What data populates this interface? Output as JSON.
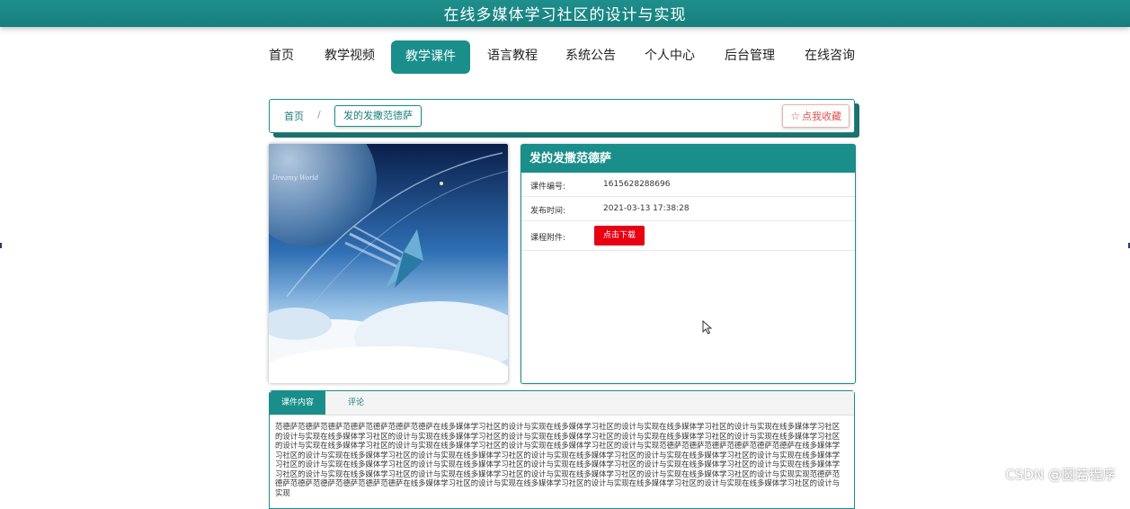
{
  "header": {
    "title": "在线多媒体学习社区的设计与实现"
  },
  "nav": {
    "items": [
      {
        "label": "首页",
        "active": false
      },
      {
        "label": "教学视频",
        "active": false
      },
      {
        "label": "教学课件",
        "active": true
      },
      {
        "label": "语言教程",
        "active": false
      },
      {
        "label": "系统公告",
        "active": false
      },
      {
        "label": "个人中心",
        "active": false
      },
      {
        "label": "后台管理",
        "active": false
      },
      {
        "label": "在线咨询",
        "active": false
      }
    ]
  },
  "breadcrumb": {
    "home": "首页",
    "separator": "/",
    "current": "发的发撒范德萨"
  },
  "favorite": {
    "icon": "star-outline-icon",
    "label": "点我收藏"
  },
  "cover": {
    "caption": "Dreamy World"
  },
  "courseware": {
    "title": "发的发撒范德萨",
    "fields": [
      {
        "label": "课件编号:",
        "value": "1615628288696"
      },
      {
        "label": "发布时间:",
        "value": "2021-03-13 17:38:28"
      }
    ],
    "attachment_label": "课程附件:",
    "download_label": "点击下载"
  },
  "tabs": [
    {
      "label": "课件内容",
      "active": true
    },
    {
      "label": "评论",
      "active": false
    }
  ],
  "content": {
    "text": "范德萨范德萨范德萨范德萨范德萨范德萨范德萨在线多媒体学习社区的设计与实现在线多媒体学习社区的设计与实现在线多媒体学习社区的设计与实现在线多媒体学习社区的设计与实现在线多媒体学习社区的设计与实现在线多媒体学习社区的设计与实现在线多媒体学习社区的设计与实现在线多媒体学习社区的设计与实现在线多媒体学习社区的设计与实现在线多媒体学习社区的设计与实现在线多媒体学习社区的设计与实现在线多媒体学习社区的设计与实现范德萨范德萨范德萨范德萨范德萨范德萨在线多媒体学习社区的设计与实现在线多媒体学习社区的设计与实现在线多媒体学习社区的设计与实现在线多媒体学习社区的设计与实现在线多媒体学习社区的设计与实现在线多媒体学习社区的设计与实现在线多媒体学习社区的设计与实现在线多媒体学习社区的设计与实现在线多媒体学习社区的设计与实现在线多媒体学习社区的设计与实现在线多媒体学习社区的设计与实现在线多媒体学习社区的设计与实现在线多媒体学习社区的设计与实现在线多媒体学习社区的设计与实现在线多媒体学习社区的设计与实现实现范德萨范德萨范德萨范德萨范德萨范德萨范德萨在线多媒体学习社区的设计与实现在线多媒体学习社区的设计与实现在线多媒体学习社区的设计与实现在线多媒体学习社区的设计与实现"
  },
  "watermark": "CSDN @圆若程序",
  "colors": {
    "primary": "#1a8e8b",
    "download": "#e60012",
    "favorite": "#d9534f"
  }
}
